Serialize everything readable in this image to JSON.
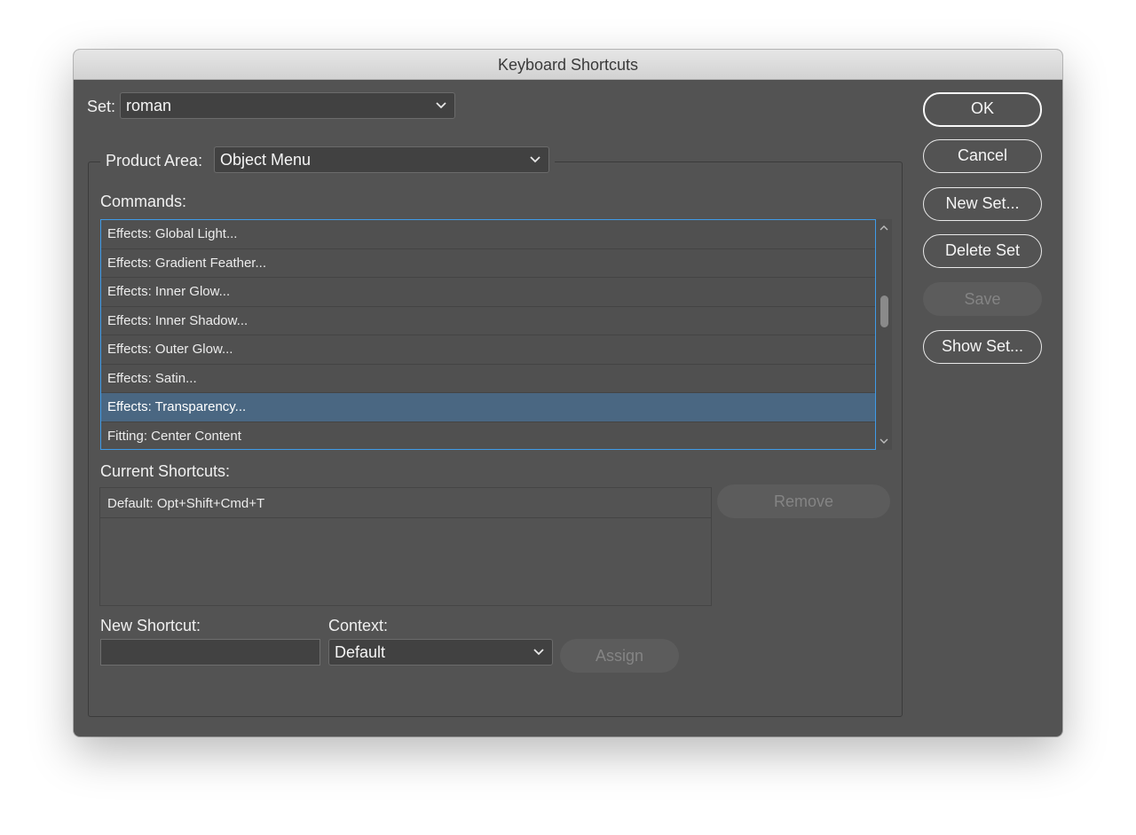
{
  "window": {
    "title": "Keyboard Shortcuts"
  },
  "set": {
    "label": "Set:",
    "value": "roman"
  },
  "product_area": {
    "label": "Product Area:",
    "value": "Object Menu"
  },
  "commands": {
    "label": "Commands:",
    "items": [
      "Effects: Global Light...",
      "Effects: Gradient Feather...",
      "Effects: Inner Glow...",
      "Effects: Inner Shadow...",
      "Effects: Outer Glow...",
      "Effects: Satin...",
      "Effects: Transparency...",
      "Fitting: Center Content"
    ],
    "selected_index": 6
  },
  "current_shortcuts": {
    "label": "Current Shortcuts:",
    "items": [
      "Default: Opt+Shift+Cmd+T"
    ],
    "remove_label": "Remove"
  },
  "new_shortcut": {
    "label": "New Shortcut:",
    "value": ""
  },
  "context": {
    "label": "Context:",
    "value": "Default"
  },
  "assign_label": "Assign",
  "buttons": {
    "ok": "OK",
    "cancel": "Cancel",
    "new_set": "New Set...",
    "delete_set": "Delete Set",
    "save": "Save",
    "show_set": "Show Set..."
  },
  "colors": {
    "dialog_bg": "#535353",
    "selection": "#4a6782",
    "focus_ring": "#3f9be8"
  },
  "icons": [
    "chevron-down-icon",
    "scroll-up-arrow-icon",
    "scroll-down-arrow-icon"
  ]
}
